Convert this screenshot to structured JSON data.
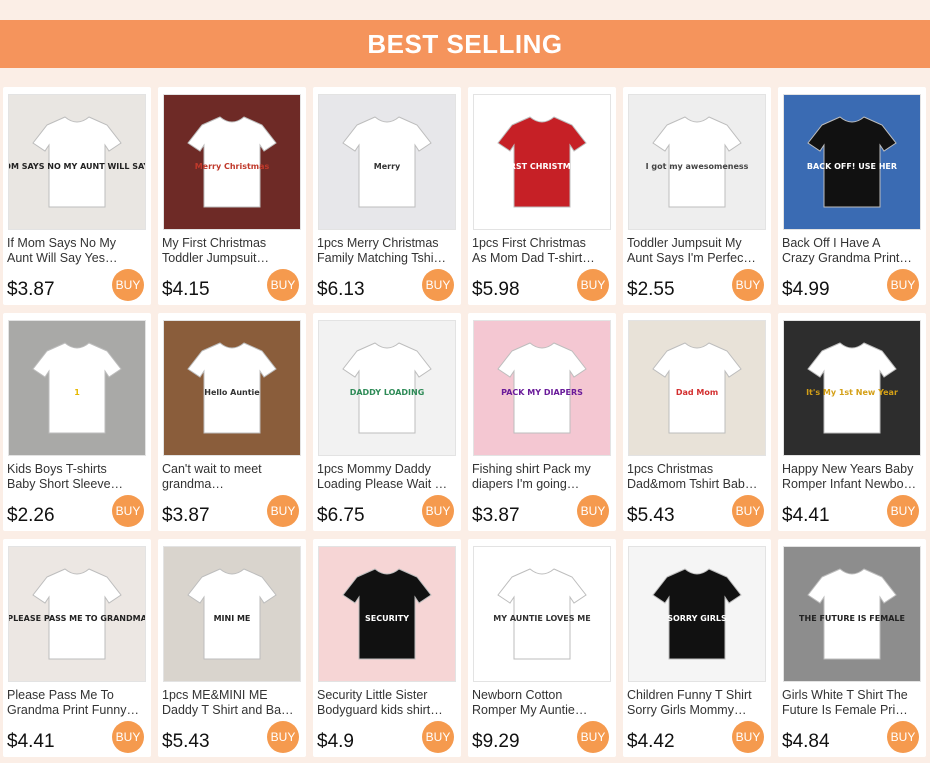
{
  "header": {
    "title": "BEST SELLING"
  },
  "buy_label": "BUY",
  "products": [
    {
      "line1": "If Mom Says No My",
      "line2": "Aunt Will Say Yes…",
      "price": "$3.87",
      "bg": "#e9e6e2",
      "shirt": "#ffffff",
      "ink": "#222222",
      "text": "IF MOM SAYS NO MY AUNT WILL SAY YES"
    },
    {
      "line1": "My First Christmas",
      "line2": "Toddler Jumpsuit…",
      "price": "$4.15",
      "bg": "#6e2a26",
      "shirt": "#ffffff",
      "ink": "#c0392b",
      "text": "Merry Christmas"
    },
    {
      "line1": "1pcs Merry Christmas",
      "line2": "Family Matching Tshi…",
      "price": "$6.13",
      "bg": "#e7e7ea",
      "shirt": "#ffffff",
      "ink": "#333333",
      "text": "Merry"
    },
    {
      "line1": "1pcs First Christmas",
      "line2": "As Mom Dad T-shirt…",
      "price": "$5.98",
      "bg": "#ffffff",
      "shirt": "#c62026",
      "ink": "#ffffff",
      "text": "FIRST CHRISTMAS"
    },
    {
      "line1": "Toddler Jumpsuit My",
      "line2": "Aunt Says I'm Perfec…",
      "price": "$2.55",
      "bg": "#eeeeee",
      "shirt": "#ffffff",
      "ink": "#444444",
      "text": "I got my awesomeness"
    },
    {
      "line1": "Back Off I Have A",
      "line2": "Crazy Grandma Print…",
      "price": "$4.99",
      "bg": "#3a6bb3",
      "shirt": "#111111",
      "ink": "#ffffff",
      "text": "BACK OFF! USE HER"
    },
    {
      "line1": "Kids Boys T-shirts",
      "line2": "Baby Short Sleeve…",
      "price": "$2.26",
      "bg": "#a9a9a7",
      "shirt": "#ffffff",
      "ink": "#e6b800",
      "text": "1"
    },
    {
      "line1": "Can't wait to meet",
      "line2": "grandma…",
      "price": "$3.87",
      "bg": "#8a5d3b",
      "shirt": "#ffffff",
      "ink": "#333333",
      "text": "Hello Auntie"
    },
    {
      "line1": "1pcs Mommy Daddy",
      "line2": "Loading Please Wait …",
      "price": "$6.75",
      "bg": "#f2f2f2",
      "shirt": "#ffffff",
      "ink": "#2e8b57",
      "text": "DADDY LOADING"
    },
    {
      "line1": "Fishing shirt Pack my",
      "line2": "diapers I'm going…",
      "price": "$3.87",
      "bg": "#f4c7d2",
      "shirt": "#ffffff",
      "ink": "#6a1b9a",
      "text": "PACK MY DIAPERS"
    },
    {
      "line1": "1pcs Christmas",
      "line2": "Dad&mom Tshirt Bab…",
      "price": "$5.43",
      "bg": "#e8e2d8",
      "shirt": "#ffffff",
      "ink": "#d32f2f",
      "text": "Dad Mom"
    },
    {
      "line1": "Happy New Years Baby",
      "line2": "Romper Infant Newbo…",
      "price": "$4.41",
      "bg": "#2d2d2d",
      "shirt": "#ffffff",
      "ink": "#d4a017",
      "text": "It's My 1st New Year"
    },
    {
      "line1": "Please Pass Me To",
      "line2": "Grandma Print Funny…",
      "price": "$4.41",
      "bg": "#ece7e3",
      "shirt": "#ffffff",
      "ink": "#222222",
      "text": "PLEASE PASS ME TO GRANDMA"
    },
    {
      "line1": "1pcs ME&MINI ME",
      "line2": "Daddy T Shirt and Ba…",
      "price": "$5.43",
      "bg": "#d9d4cd",
      "shirt": "#ffffff",
      "ink": "#222222",
      "text": "MINI ME"
    },
    {
      "line1": "Security Little Sister",
      "line2": "Bodyguard kids shirt…",
      "price": "$4.9",
      "bg": "#f6d5d5",
      "shirt": "#111111",
      "ink": "#ffffff",
      "text": "SECURITY"
    },
    {
      "line1": "Newborn Cotton",
      "line2": "Romper My Auntie…",
      "price": "$9.29",
      "bg": "#ffffff",
      "shirt": "#ffffff",
      "ink": "#333333",
      "text": "MY AUNTIE LOVES ME"
    },
    {
      "line1": "Children Funny T Shirt",
      "line2": "Sorry Girls Mommy…",
      "price": "$4.42",
      "bg": "#f5f5f5",
      "shirt": "#111111",
      "ink": "#ffffff",
      "text": "SORRY GIRLS"
    },
    {
      "line1": "Girls White T Shirt The",
      "line2": "Future Is Female Pri…",
      "price": "$4.84",
      "bg": "#8d8d8d",
      "shirt": "#ffffff",
      "ink": "#222222",
      "text": "THE FUTURE IS FEMALE"
    }
  ]
}
